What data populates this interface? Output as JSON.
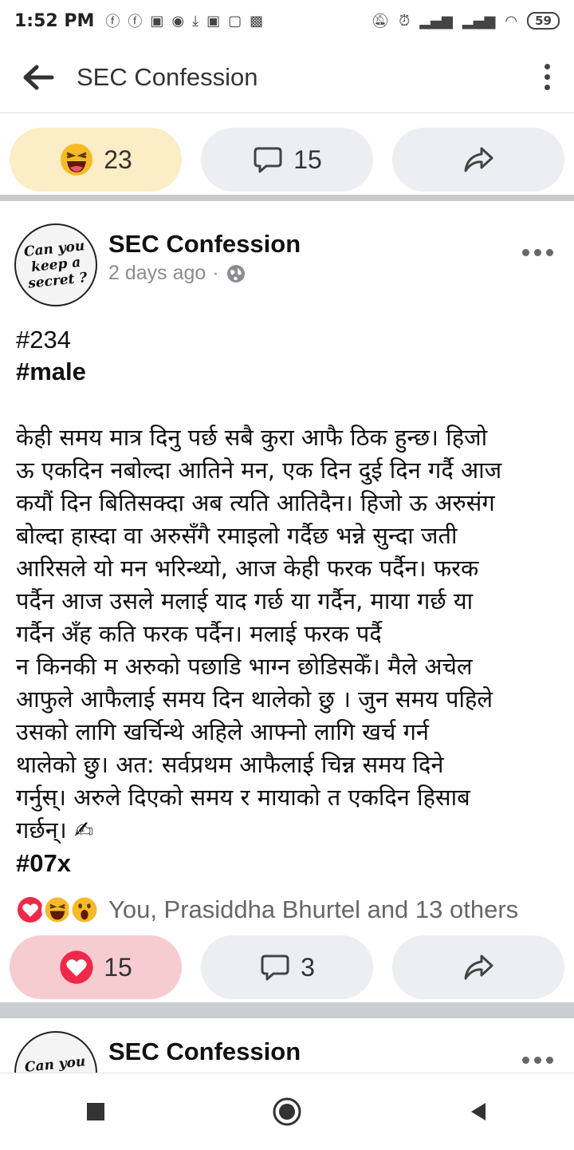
{
  "status_bar": {
    "time": "1:52 PM",
    "battery": "59"
  },
  "app_bar": {
    "title": "SEC Confession"
  },
  "prev_post_actions": {
    "reaction_count": "23",
    "comment_count": "15"
  },
  "post": {
    "page_name": "SEC Confession",
    "time_ago": "2 days ago",
    "meta_sep": "·",
    "avatar_text": "Can you\nkeep a\nsecret ?",
    "hashtag_number": "#234",
    "hashtag_gender": "#male",
    "body": "केही समय मात्र दिनु पर्छ सबै कुरा आफै ठिक हुन्छ। हिजो\nऊ एकदिन नबोल्दा आतिने मन, एक दिन दुई दिन गर्दै आज\nकयौं दिन बितिसक्दा अब त्यति आतिदैन। हिजो ऊ अरुसंग\nबोल्दा हास्दा वा अरुसँगै रमाइलो गर्दैछ भन्ने सुन्दा जती\nआरिसले यो मन भरिन्थ्यो, आज केही फरक पर्दैन। फरक\nपर्दैन आज उसले मलाई याद गर्छ या गर्दैन, माया गर्छ या\nगर्दैन अँह कति फरक पर्दैन। मलाई फरक पर्दै\nन किनकी म अरुको पछाडि भाग्न छोडिसकेँ। मैले अचेल\nआफुले आफैलाई समय दिन थालेको छु । जुन समय पहिले\nउसको लागि खर्चिन्थे अहिले आफ्नो लागि खर्च गर्न\nथालेको छु। अत: सर्वप्रथम आफैलाई चिन्न समय दिने\nगर्नुस्। अरुले दिएको समय र मायाको त एकदिन हिसाब\nगर्छन्। ✍",
    "signature_tag": "#07x",
    "reactions_text": "You, Prasiddha Bhurtel and 13 others",
    "love_count": "15",
    "comment_count": "3"
  },
  "next_post": {
    "page_name": "SEC Confession",
    "avatar_text": "Can you\nkeep a"
  },
  "colors": {
    "haha_bg": "#fbedc5",
    "love_bg": "#f7ccd1",
    "pill_bg": "#eceef2",
    "separator": "#c9ccd1",
    "meta_text": "#8a8d91"
  },
  "icons": [
    "back-arrow-icon",
    "overflow-menu-icon",
    "haha-emoji-icon",
    "comment-icon",
    "share-icon",
    "globe-icon",
    "love-icon",
    "wow-emoji-icon",
    "writing-hand-icon",
    "nav-stop-icon",
    "nav-home-icon",
    "nav-back-icon"
  ]
}
